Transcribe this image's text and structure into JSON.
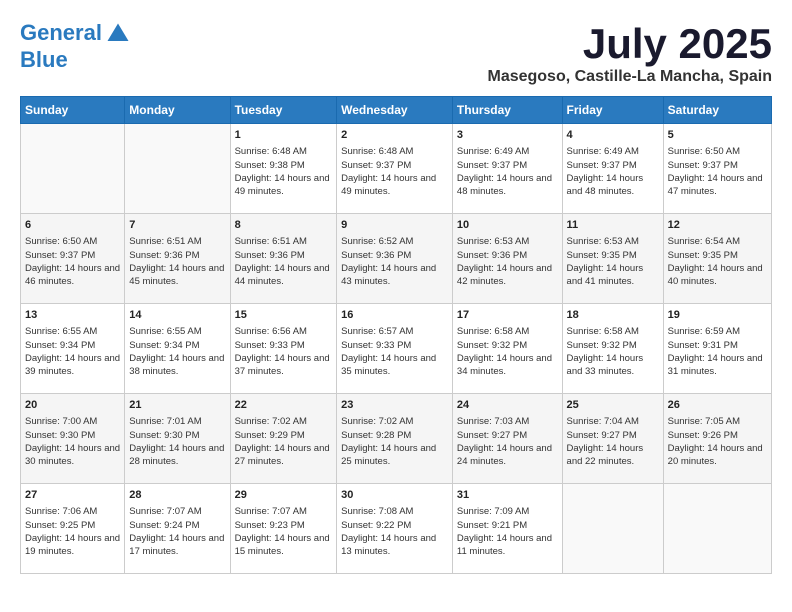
{
  "header": {
    "logo_line1": "General",
    "logo_line2": "Blue",
    "month": "July 2025",
    "location": "Masegoso, Castille-La Mancha, Spain"
  },
  "weekdays": [
    "Sunday",
    "Monday",
    "Tuesday",
    "Wednesday",
    "Thursday",
    "Friday",
    "Saturday"
  ],
  "weeks": [
    [
      {
        "day": "",
        "info": ""
      },
      {
        "day": "",
        "info": ""
      },
      {
        "day": "1",
        "info": "Sunrise: 6:48 AM\nSunset: 9:38 PM\nDaylight: 14 hours and 49 minutes."
      },
      {
        "day": "2",
        "info": "Sunrise: 6:48 AM\nSunset: 9:37 PM\nDaylight: 14 hours and 49 minutes."
      },
      {
        "day": "3",
        "info": "Sunrise: 6:49 AM\nSunset: 9:37 PM\nDaylight: 14 hours and 48 minutes."
      },
      {
        "day": "4",
        "info": "Sunrise: 6:49 AM\nSunset: 9:37 PM\nDaylight: 14 hours and 48 minutes."
      },
      {
        "day": "5",
        "info": "Sunrise: 6:50 AM\nSunset: 9:37 PM\nDaylight: 14 hours and 47 minutes."
      }
    ],
    [
      {
        "day": "6",
        "info": "Sunrise: 6:50 AM\nSunset: 9:37 PM\nDaylight: 14 hours and 46 minutes."
      },
      {
        "day": "7",
        "info": "Sunrise: 6:51 AM\nSunset: 9:36 PM\nDaylight: 14 hours and 45 minutes."
      },
      {
        "day": "8",
        "info": "Sunrise: 6:51 AM\nSunset: 9:36 PM\nDaylight: 14 hours and 44 minutes."
      },
      {
        "day": "9",
        "info": "Sunrise: 6:52 AM\nSunset: 9:36 PM\nDaylight: 14 hours and 43 minutes."
      },
      {
        "day": "10",
        "info": "Sunrise: 6:53 AM\nSunset: 9:36 PM\nDaylight: 14 hours and 42 minutes."
      },
      {
        "day": "11",
        "info": "Sunrise: 6:53 AM\nSunset: 9:35 PM\nDaylight: 14 hours and 41 minutes."
      },
      {
        "day": "12",
        "info": "Sunrise: 6:54 AM\nSunset: 9:35 PM\nDaylight: 14 hours and 40 minutes."
      }
    ],
    [
      {
        "day": "13",
        "info": "Sunrise: 6:55 AM\nSunset: 9:34 PM\nDaylight: 14 hours and 39 minutes."
      },
      {
        "day": "14",
        "info": "Sunrise: 6:55 AM\nSunset: 9:34 PM\nDaylight: 14 hours and 38 minutes."
      },
      {
        "day": "15",
        "info": "Sunrise: 6:56 AM\nSunset: 9:33 PM\nDaylight: 14 hours and 37 minutes."
      },
      {
        "day": "16",
        "info": "Sunrise: 6:57 AM\nSunset: 9:33 PM\nDaylight: 14 hours and 35 minutes."
      },
      {
        "day": "17",
        "info": "Sunrise: 6:58 AM\nSunset: 9:32 PM\nDaylight: 14 hours and 34 minutes."
      },
      {
        "day": "18",
        "info": "Sunrise: 6:58 AM\nSunset: 9:32 PM\nDaylight: 14 hours and 33 minutes."
      },
      {
        "day": "19",
        "info": "Sunrise: 6:59 AM\nSunset: 9:31 PM\nDaylight: 14 hours and 31 minutes."
      }
    ],
    [
      {
        "day": "20",
        "info": "Sunrise: 7:00 AM\nSunset: 9:30 PM\nDaylight: 14 hours and 30 minutes."
      },
      {
        "day": "21",
        "info": "Sunrise: 7:01 AM\nSunset: 9:30 PM\nDaylight: 14 hours and 28 minutes."
      },
      {
        "day": "22",
        "info": "Sunrise: 7:02 AM\nSunset: 9:29 PM\nDaylight: 14 hours and 27 minutes."
      },
      {
        "day": "23",
        "info": "Sunrise: 7:02 AM\nSunset: 9:28 PM\nDaylight: 14 hours and 25 minutes."
      },
      {
        "day": "24",
        "info": "Sunrise: 7:03 AM\nSunset: 9:27 PM\nDaylight: 14 hours and 24 minutes."
      },
      {
        "day": "25",
        "info": "Sunrise: 7:04 AM\nSunset: 9:27 PM\nDaylight: 14 hours and 22 minutes."
      },
      {
        "day": "26",
        "info": "Sunrise: 7:05 AM\nSunset: 9:26 PM\nDaylight: 14 hours and 20 minutes."
      }
    ],
    [
      {
        "day": "27",
        "info": "Sunrise: 7:06 AM\nSunset: 9:25 PM\nDaylight: 14 hours and 19 minutes."
      },
      {
        "day": "28",
        "info": "Sunrise: 7:07 AM\nSunset: 9:24 PM\nDaylight: 14 hours and 17 minutes."
      },
      {
        "day": "29",
        "info": "Sunrise: 7:07 AM\nSunset: 9:23 PM\nDaylight: 14 hours and 15 minutes."
      },
      {
        "day": "30",
        "info": "Sunrise: 7:08 AM\nSunset: 9:22 PM\nDaylight: 14 hours and 13 minutes."
      },
      {
        "day": "31",
        "info": "Sunrise: 7:09 AM\nSunset: 9:21 PM\nDaylight: 14 hours and 11 minutes."
      },
      {
        "day": "",
        "info": ""
      },
      {
        "day": "",
        "info": ""
      }
    ]
  ]
}
